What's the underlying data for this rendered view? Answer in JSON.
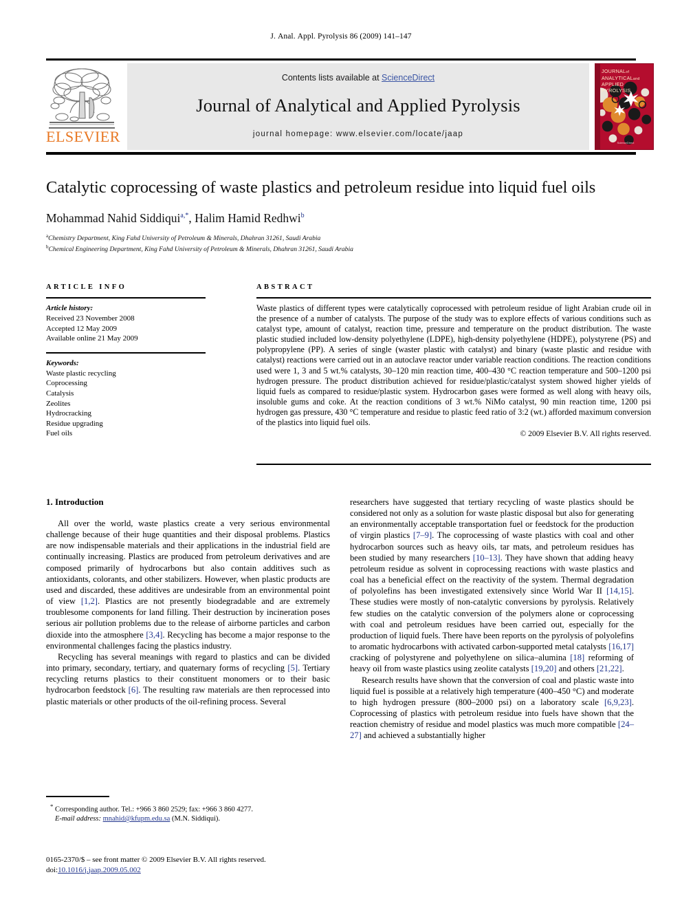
{
  "running_head": "J. Anal. Appl. Pyrolysis 86 (2009) 141–147",
  "masthead": {
    "contents_prefix": "Contents lists available at ",
    "sciencedirect": "ScienceDirect",
    "journal_title": "Journal of Analytical and Applied Pyrolysis",
    "homepage": "journal homepage: www.elsevier.com/locate/jaap",
    "elsevier_wordmark": "ELSEVIER",
    "elsevier_orange": "#E87722",
    "link_color": "#3b55a4",
    "band_color": "#e8e8e8",
    "cover": {
      "line1": "JOURNAL",
      "line1_small": "of",
      "line2": "ANALYTICAL",
      "line2_small": "and",
      "line3": "APPLIED PYROLYSIS",
      "footer": "ScienceDirect",
      "background": "#b40d2e",
      "accent": "#e08a2e"
    }
  },
  "title": "Catalytic coprocessing of waste plastics and petroleum residue into liquid fuel oils",
  "authors": {
    "name1": "Mohammad Nahid Siddiqui",
    "sup1": "a,*",
    "separator": ", ",
    "name2": "Halim Hamid Redhwi",
    "sup2": "b"
  },
  "affiliations": [
    {
      "marker": "a",
      "text": "Chemistry Department, King Fahd University of Petroleum & Minerals, Dhahran 31261, Saudi Arabia"
    },
    {
      "marker": "b",
      "text": "Chemical Engineering Department, King Fahd University of Petroleum & Minerals, Dhahran 31261, Saudi Arabia"
    }
  ],
  "article_info": {
    "heading": "ARTICLE INFO",
    "history_label": "Article history:",
    "history": [
      "Received 23 November 2008",
      "Accepted 12 May 2009",
      "Available online 21 May 2009"
    ],
    "keywords_label": "Keywords:",
    "keywords": [
      "Waste plastic recycling",
      "Coprocessing",
      "Catalysis",
      "Zeolites",
      "Hydrocracking",
      "Residue upgrading",
      "Fuel oils"
    ]
  },
  "abstract": {
    "heading": "ABSTRACT",
    "text": "Waste plastics of different types were catalytically coprocessed with petroleum residue of light Arabian crude oil in the presence of a number of catalysts. The purpose of the study was to explore effects of various conditions such as catalyst type, amount of catalyst, reaction time, pressure and temperature on the product distribution. The waste plastic studied included low-density polyethylene (LDPE), high-density polyethylene (HDPE), polystyrene (PS) and polypropylene (PP). A series of single (waster plastic with catalyst) and binary (waste plastic and residue with catalyst) reactions were carried out in an autoclave reactor under variable reaction conditions. The reaction conditions used were 1, 3 and 5 wt.% catalysts, 30–120 min reaction time, 400–430 °C reaction temperature and 500–1200 psi hydrogen pressure. The product distribution achieved for residue/plastic/catalyst system showed higher yields of liquid fuels as compared to residue/plastic system. Hydrocarbon gases were formed as well along with heavy oils, insoluble gums and coke. At the reaction conditions of 3 wt.% NiMo catalyst, 90 min reaction time, 1200 psi hydrogen gas pressure, 430 °C temperature and residue to plastic feed ratio of 3:2 (wt.) afforded maximum conversion of the plastics into liquid fuel oils.",
    "copyright": "© 2009 Elsevier B.V. All rights reserved."
  },
  "section": {
    "heading": "1. Introduction"
  },
  "body": {
    "left_paragraphs": [
      "All over the world, waste plastics create a very serious environmental challenge because of their huge quantities and their disposal problems. Plastics are now indispensable materials and their applications in the industrial field are continually increasing. Plastics are produced from petroleum derivatives and are composed primarily of hydrocarbons but also contain additives such as antioxidants, colorants, and other stabilizers. However, when plastic products are used and discarded, these additives are undesirable from an environmental point of view [1,2]. Plastics are not presently biodegradable and are extremely troublesome components for land filling. Their destruction by incineration poses serious air pollution problems due to the release of airborne particles and carbon dioxide into the atmosphere [3,4]. Recycling has become a major response to the environmental challenges facing the plastics industry.",
      "Recycling has several meanings with regard to plastics and can be divided into primary, secondary, tertiary, and quaternary forms of recycling [5]. Tertiary recycling returns plastics to their constituent monomers or to their basic hydrocarbon feedstock [6]. The resulting raw materials are then reprocessed into plastic materials or other products of the oil-refining process. Several"
    ],
    "right_paragraphs": [
      "researchers have suggested that tertiary recycling of waste plastics should be considered not only as a solution for waste plastic disposal but also for generating an environmentally acceptable transportation fuel or feedstock for the production of virgin plastics [7–9]. The coprocessing of waste plastics with coal and other hydrocarbon sources such as heavy oils, tar mats, and petroleum residues has been studied by many researchers [10–13]. They have shown that adding heavy petroleum residue as solvent in coprocessing reactions with waste plastics and coal has a beneficial effect on the reactivity of the system. Thermal degradation of polyolefins has been investigated extensively since World War II [14,15]. These studies were mostly of non-catalytic conversions by pyrolysis. Relatively few studies on the catalytic conversion of the polymers alone or coprocessing with coal and petroleum residues have been carried out, especially for the production of liquid fuels. There have been reports on the pyrolysis of polyolefins to aromatic hydrocarbons with activated carbon-supported metal catalysts [16,17] cracking of polystyrene and polyethylene on silica–alumina [18] reforming of heavy oil from waste plastics using zeolite catalysts [19,20] and others [21,22].",
      "Research results have shown that the conversion of coal and plastic waste into liquid fuel is possible at a relatively high temperature (400–450 °C) and moderate to high hydrogen pressure (800–2000 psi) on a laboratory scale [6,9,23]. Coprocessing of plastics with petroleum residue into fuels have shown that the reaction chemistry of residue and model plastics was much more compatible [24–27] and achieved a substantially higher"
    ]
  },
  "footnote": {
    "marker": "*",
    "line1": "Corresponding author. Tel.: +966 3 860 2529; fax: +966 3 860 4277.",
    "email_label": "E-mail address:",
    "email": "mnahid@kfupm.edu.sa",
    "email_suffix": " (M.N. Siddiqui)."
  },
  "colophon": {
    "line1": "0165-2370/$ – see front matter © 2009 Elsevier B.V. All rights reserved.",
    "doi_label": "doi:",
    "doi": "10.1016/j.jaap.2009.05.002"
  }
}
